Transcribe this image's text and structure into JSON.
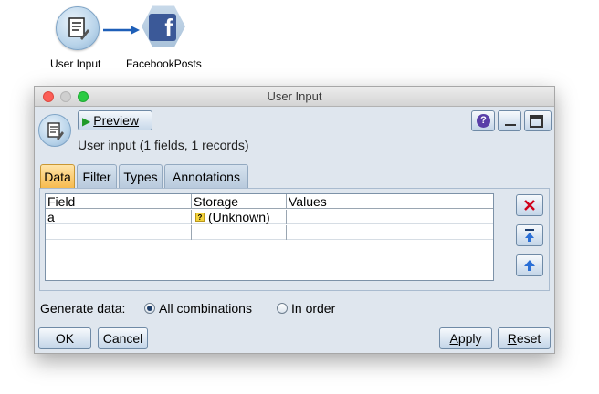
{
  "canvas": {
    "nodes": [
      {
        "label": "User Input",
        "icon": "user-input-icon"
      },
      {
        "label": "FacebookPosts",
        "icon": "facebook-icon"
      }
    ]
  },
  "window": {
    "title": "User Input",
    "preview_label": "Preview",
    "info": "User input (1 fields, 1 records)",
    "help_glyph": "?"
  },
  "tabs": [
    "Data",
    "Filter",
    "Types",
    "Annotations"
  ],
  "active_tab": "Data",
  "table": {
    "headers": [
      "Field",
      "Storage",
      "Values"
    ],
    "rows": [
      {
        "field": "a",
        "storage": "(Unknown)",
        "values": ""
      }
    ],
    "unknown_glyph": "?"
  },
  "generate": {
    "label": "Generate data:",
    "options": [
      "All combinations",
      "In order"
    ],
    "selected": "All combinations"
  },
  "buttons": {
    "ok": "OK",
    "cancel": "Cancel",
    "apply": "Apply",
    "reset": "Reset"
  },
  "colors": {
    "active_tab": "#f6b94b",
    "facebook": "#3b5998",
    "delete": "#d0021b",
    "move": "#2a6fd6"
  }
}
